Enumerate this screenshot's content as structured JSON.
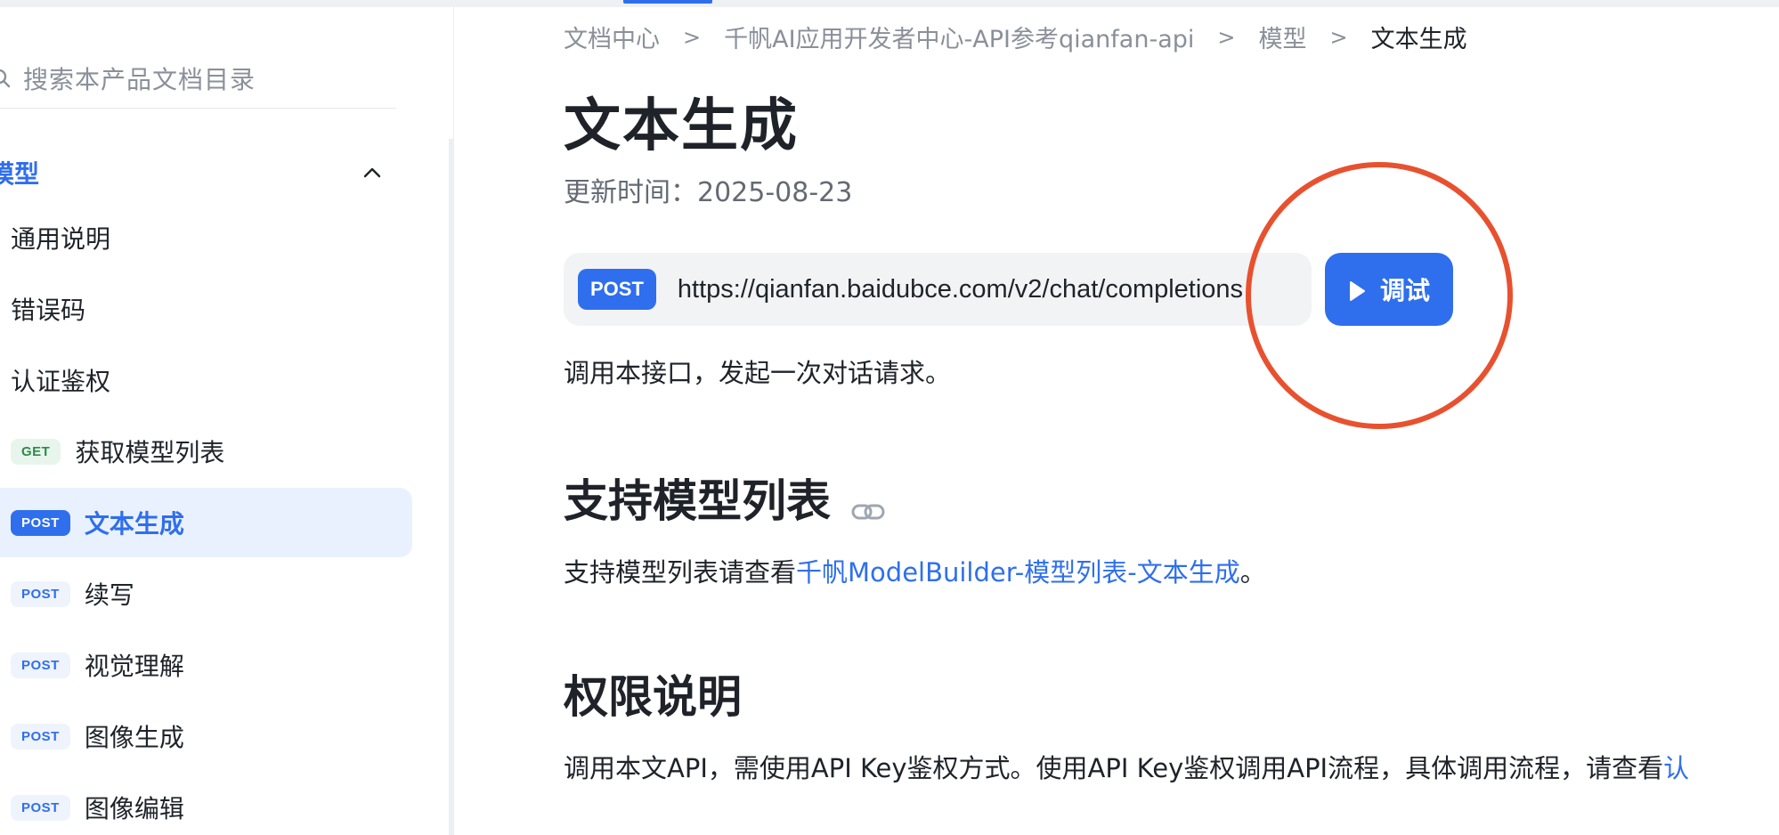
{
  "sidebar": {
    "search_placeholder": "搜索本产品文档目录",
    "group_title": "模型",
    "items": [
      {
        "label": "通用说明",
        "method": ""
      },
      {
        "label": "错误码",
        "method": ""
      },
      {
        "label": "认证鉴权",
        "method": ""
      },
      {
        "label": "获取模型列表",
        "method": "GET"
      },
      {
        "label": "文本生成",
        "method": "POST",
        "active": true
      },
      {
        "label": "续写",
        "method": "POST"
      },
      {
        "label": "视觉理解",
        "method": "POST"
      },
      {
        "label": "图像生成",
        "method": "POST"
      },
      {
        "label": "图像编辑",
        "method": "POST"
      }
    ]
  },
  "breadcrumb": {
    "items": [
      "文档中心",
      "千帆AI应用开发者中心-API参考qianfan-api",
      "模型",
      "文本生成"
    ],
    "separator": ">"
  },
  "main": {
    "title": "文本生成",
    "update_time": "更新时间：2025-08-23",
    "endpoint": {
      "method": "POST",
      "url": "https://qianfan.baidubce.com/v2/chat/completions"
    },
    "try_button_label": "调试",
    "description": "调用本接口，发起一次对话请求。",
    "section_models": {
      "title": "支持模型列表",
      "text_prefix": "支持模型列表请查看",
      "link_text": "千帆ModelBuilder-模型列表-文本生成",
      "text_suffix": "。"
    },
    "section_permissions": {
      "title": "权限说明",
      "text": "调用本文API，需使用API Key鉴权方式。使用API Key鉴权调用API流程，具体调用流程，请查看",
      "link_text": "认"
    }
  },
  "colors": {
    "accent": "#2f6fed",
    "highlight_circle": "#e8512f",
    "active_item_bg": "#eaf1fe",
    "endpoint_bg": "#f2f3f5"
  },
  "icons": {
    "search": "search-icon",
    "collapse": "chevron-up-icon",
    "anchor": "link-icon",
    "play": "play-icon"
  }
}
